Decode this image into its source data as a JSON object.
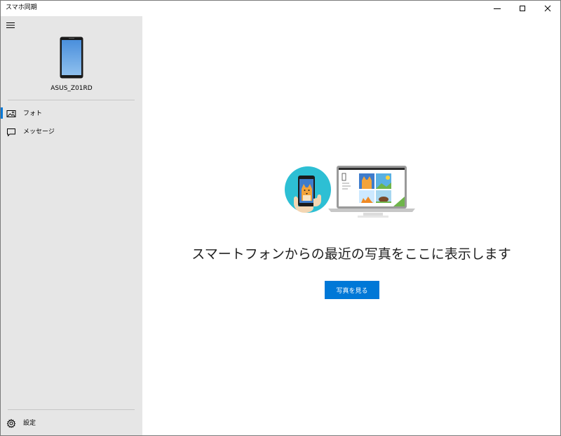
{
  "window": {
    "title": "スマホ同期"
  },
  "sidebar": {
    "device_name": "ASUS_Z01RD",
    "items": [
      {
        "label": "フォト",
        "icon": "photo-icon",
        "selected": true
      },
      {
        "label": "メッセージ",
        "icon": "message-icon",
        "selected": false
      }
    ],
    "settings_label": "設定"
  },
  "main": {
    "heading": "スマートフォンからの最近の写真をここに表示します",
    "button_label": "写真を見る"
  },
  "colors": {
    "accent": "#0078d7",
    "sidebar_bg": "#e6e6e6"
  }
}
